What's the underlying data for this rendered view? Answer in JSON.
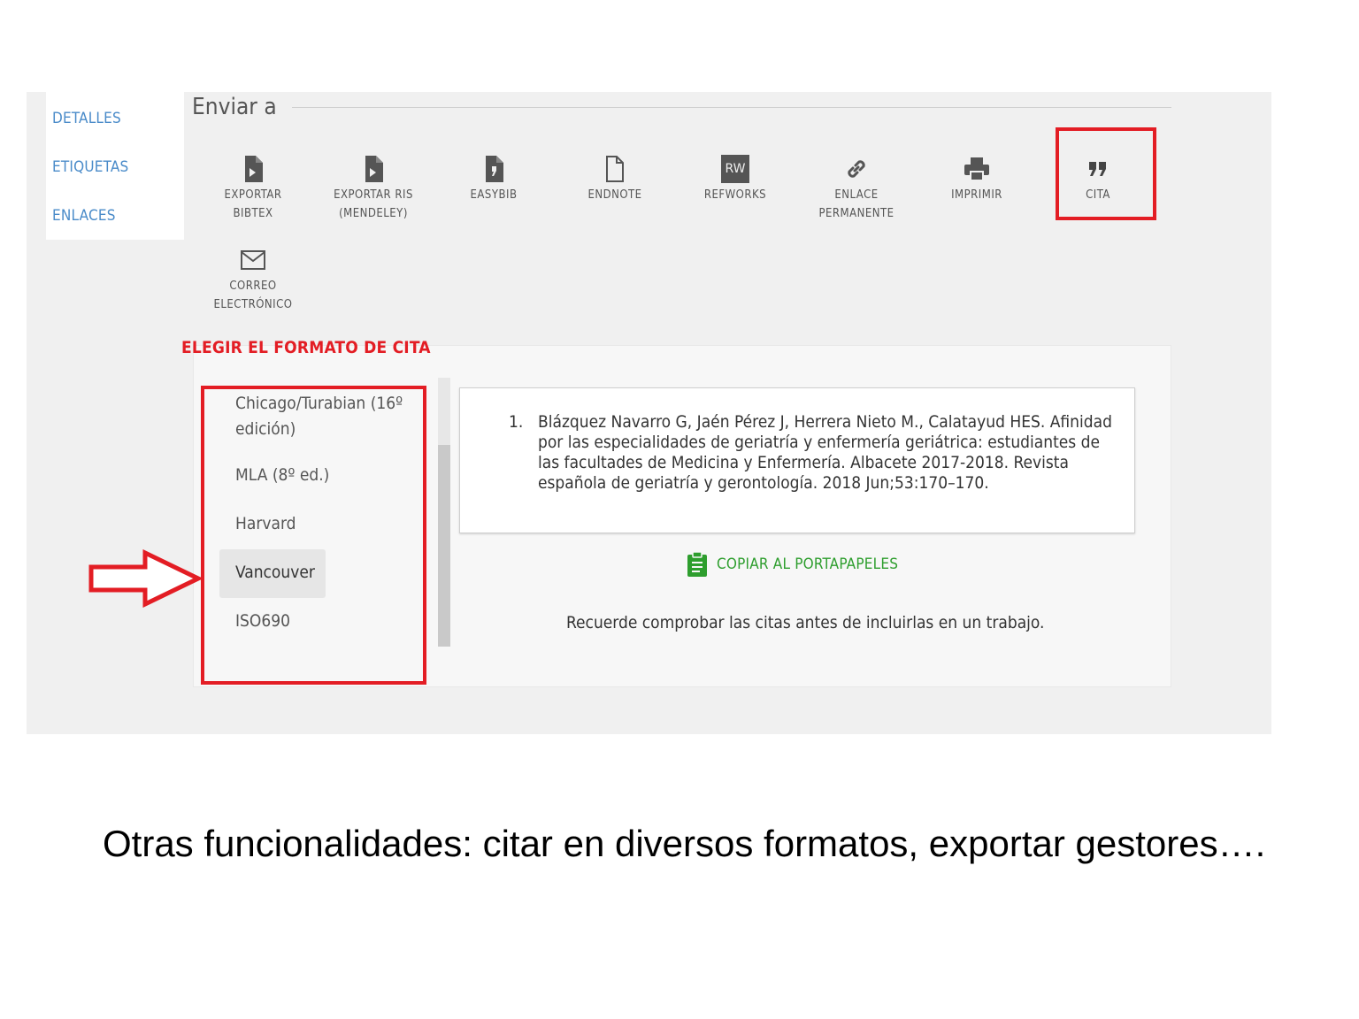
{
  "sidebar": {
    "items": [
      {
        "label": "DETALLES"
      },
      {
        "label": "ETIQUETAS"
      },
      {
        "label": "ENLACES"
      }
    ]
  },
  "send_to": {
    "title": "Enviar a",
    "actions": [
      {
        "label_1": "EXPORTAR",
        "label_2": "BIBTEX",
        "icon": "file-export-icon"
      },
      {
        "label_1": "EXPORTAR RIS",
        "label_2": "(MENDELEY)",
        "icon": "file-export-icon"
      },
      {
        "label_1": "EASYBIB",
        "label_2": "",
        "icon": "easybib-icon"
      },
      {
        "label_1": "ENDNOTE",
        "label_2": "",
        "icon": "document-icon"
      },
      {
        "label_1": "REFWORKS",
        "label_2": "",
        "icon": "refworks-icon",
        "icon_text": "RW"
      },
      {
        "label_1": "ENLACE",
        "label_2": "PERMANENTE",
        "icon": "link-icon"
      },
      {
        "label_1": "IMPRIMIR",
        "label_2": "",
        "icon": "printer-icon"
      },
      {
        "label_1": "CITA",
        "label_2": "",
        "icon": "quote-icon"
      },
      {
        "label_1": "CORREO",
        "label_2": "ELECTRÓNICO",
        "icon": "envelope-icon"
      }
    ]
  },
  "annotation": {
    "choose_format": "ELEGIR EL FORMATO DE CITA",
    "highlight_color": "#e31d24"
  },
  "formats": {
    "items": [
      {
        "line_1": "Chicago/Turabian (16º",
        "line_2": "edición)"
      },
      {
        "line_1": "MLA (8º ed.)"
      },
      {
        "line_1": "Harvard"
      },
      {
        "line_1": "Vancouver"
      },
      {
        "line_1": "ISO690"
      }
    ],
    "selected": "Vancouver"
  },
  "citation": {
    "number": "1.",
    "text": "Blázquez Navarro G, Jaén Pérez J, Herrera Nieto M., Calatayud HES. Afinidad por las especialidades de geriatría y enfermería geriátrica: estudiantes de las facultades de Medicina y Enfermería. Albacete 2017-2018. Revista española de geriatría y gerontología. 2018 Jun;53:170–170.",
    "copy_label": "COPIAR AL PORTAPAPELES",
    "copy_color": "#2e9e2e",
    "reminder": "Recuerde comprobar las citas antes de incluirlas en un trabajo."
  },
  "caption": "Otras funcionalidades: citar en diversos formatos, exportar gestores…."
}
